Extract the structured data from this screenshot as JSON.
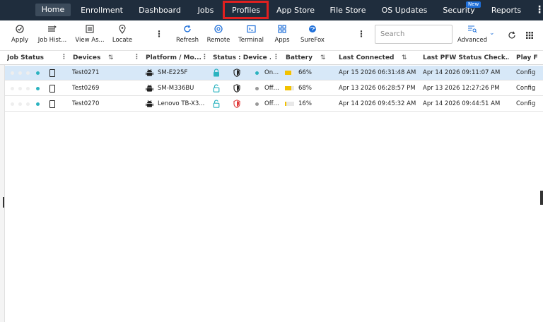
{
  "nav": {
    "items": [
      "Home",
      "Enrollment",
      "Dashboard",
      "Jobs",
      "Profiles",
      "App Store",
      "File Store",
      "OS Updates",
      "Security",
      "Reports"
    ],
    "active": "Home",
    "highlighted": "Profiles",
    "new_badge": "New",
    "more_icon": "vertical-ellipsis"
  },
  "toolbar": {
    "apply": "Apply",
    "job_history": "Job Hist...",
    "view_as": "View As...",
    "locate": "Locate",
    "refresh": "Refresh",
    "remote": "Remote",
    "terminal": "Terminal",
    "apps": "Apps",
    "surefox": "SureFox",
    "advanced": "Advanced",
    "search_placeholder": "Search"
  },
  "columns": [
    "Job Status",
    "Devices",
    "Platform / Mo...",
    "Status : Device ...",
    "Battery",
    "Last Connected",
    "Last PFW Status Check...",
    "Play F"
  ],
  "rows": [
    {
      "device": "Test0271",
      "model": "SM-E225F",
      "lock": "locked",
      "shield": "ok",
      "status_dot": "#2bb3c0",
      "status": "On...",
      "battery": 66,
      "battery_text": "66%",
      "last_connected": "Apr 15 2026 06:31:48 AM",
      "pfw_check": "Apr 14 2026 09:11:07 AM",
      "play": "Config",
      "selected": true
    },
    {
      "device": "Test0269",
      "model": "SM-M336BU",
      "lock": "unlocked",
      "shield": "ok",
      "status_dot": "#999999",
      "status": "Off...",
      "battery": 68,
      "battery_text": "68%",
      "last_connected": "Apr 13 2026 06:28:57 PM",
      "pfw_check": "Apr 13 2026 12:27:26 PM",
      "play": "Config",
      "selected": false
    },
    {
      "device": "Test0270",
      "model": "Lenovo TB-X3...",
      "lock": "unlocked",
      "shield": "alert",
      "status_dot": "#999999",
      "status": "Off...",
      "battery": 16,
      "battery_text": "16%",
      "last_connected": "Apr 14 2026 09:45:32 AM",
      "pfw_check": "Apr 14 2026 09:44:51 AM",
      "play": "Config",
      "selected": false
    }
  ],
  "colors": {
    "nav_bg": "#1f2d3d",
    "accent": "#1e6fd9",
    "highlight": "#e02020",
    "online": "#2bb3c0",
    "battery": "#f2c200",
    "selected_row": "#d7e8f8"
  }
}
